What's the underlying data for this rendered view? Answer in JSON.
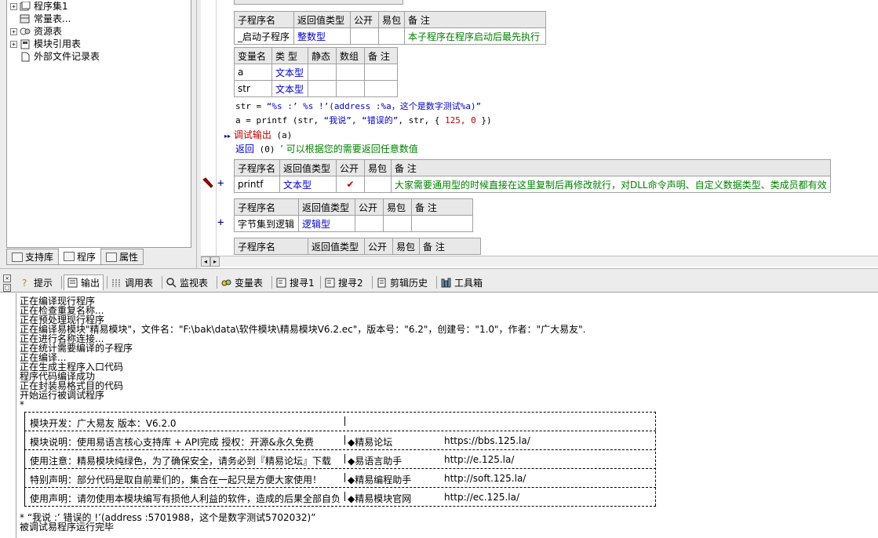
{
  "tree": {
    "items": [
      {
        "label": "程序集1",
        "icon": "assembly-icon",
        "expander": "+"
      },
      {
        "label": "常量表...",
        "icon": "constant-icon",
        "expander": ""
      },
      {
        "label": "资源表",
        "icon": "resource-icon",
        "expander": "+"
      },
      {
        "label": "模块引用表",
        "icon": "module-icon",
        "expander": "+"
      },
      {
        "label": "外部文件记录表",
        "icon": "file-icon",
        "expander": ""
      }
    ]
  },
  "left_tabs": [
    {
      "label": "支持库",
      "icon": "library-icon"
    },
    {
      "label": "程序",
      "icon": "program-icon"
    },
    {
      "label": "属性",
      "icon": "property-icon"
    }
  ],
  "editor": {
    "sub1": {
      "headers": [
        "子程序名",
        "返回值类型",
        "公开",
        "易包",
        "备 注"
      ],
      "row": [
        "_启动子程序",
        "整数型",
        "",
        "",
        "本子程序在程序启动后最先执行"
      ]
    },
    "vars": {
      "headers": [
        "变量名",
        "类 型",
        "静态",
        "数组",
        "备 注"
      ],
      "rows": [
        [
          "a",
          "文本型",
          "",
          "",
          ""
        ],
        [
          "str",
          "文本型",
          "",
          "",
          ""
        ]
      ]
    },
    "code": {
      "line1_a": "str = ",
      "line1_b": "“%s :’ %s !’(address :%a，这个是数字测试%a)”",
      "line2_a": "a = printf (str, ",
      "line2_b": "“我说”, “错误的”",
      "line2_c": ", str, { ",
      "line2_d": "125, 0",
      "line2_e": " })",
      "line3_arrow": "▸▸",
      "line3_a": "调试输出",
      "line3_b": " (a)",
      "line4_a": "返回",
      "line4_b": " (0)  ",
      "line4_c": "’ 可以根据您的需要返回任意数值"
    },
    "sub2": {
      "headers": [
        "子程序名",
        "返回值类型",
        "公开",
        "易包",
        "备 注"
      ],
      "row": [
        "printf",
        "文本型",
        "✔",
        "",
        "大家需要通用型的时候直接在这里复制后再修改就行，对DLL命令声明、自定义数据类型、类成员都有效"
      ]
    },
    "sub3": {
      "headers": [
        "子程序名",
        "返回值类型",
        "公开",
        "易包",
        "备 注"
      ],
      "row": [
        "字节集到逻辑",
        "逻辑型",
        "",
        "",
        ""
      ]
    },
    "sub4": {
      "headers": [
        "子程序名",
        "返回值类型",
        "公开",
        "易包",
        "备 注"
      ]
    },
    "plus": "+"
  },
  "bottom_tabs": [
    {
      "label": "提示",
      "icon": "hint-icon"
    },
    {
      "label": "输出",
      "icon": "output-icon"
    },
    {
      "label": "调用表",
      "icon": "callstack-icon"
    },
    {
      "label": "监视表",
      "icon": "watch-icon"
    },
    {
      "label": "变量表",
      "icon": "variables-icon"
    },
    {
      "label": "搜寻1",
      "icon": "search1-icon"
    },
    {
      "label": "搜寻2",
      "icon": "search2-icon"
    },
    {
      "label": "剪辑历史",
      "icon": "clip-history-icon"
    },
    {
      "label": "工具箱",
      "icon": "toolbox-icon"
    }
  ],
  "output": {
    "lines": [
      "正在编译现行程序",
      "正在检查重复名称...",
      "正在预处理现行程序",
      "正在编译易模块\"精易模块\"，文件名：\"F:\\bak\\data\\软件模块\\精易模块V6.2.ec\"，版本号：\"6.2\"，创建号：\"1.0\"，作者：\"广大易友\".",
      "正在进行名称连接...",
      "正在统计需要编译的子程序",
      "正在编译...",
      "正在生成主程序入口代码",
      "程序代码编译成功",
      "正在封装易格式目的代码",
      "开始运行被调试程序",
      "*"
    ],
    "box": {
      "row1_left": "模块开发：广大易友    版本：V6.2.0",
      "row2_left": "模块说明：使用易语言核心支持库 + API完成     授权：开源&永久免费",
      "row2_right_label": "◆精易论坛",
      "row2_right_url": "https://bbs.125.la/",
      "row3_left": "使用注意：精易模块纯绿色，为了确保安全，请务必到『精易论坛』下载",
      "row3_right_label": "◆易语言助手",
      "row3_right_url": "http://e.125.la/",
      "row4_left": "特别声明：部分代码是取自前辈们的，集合在一起只是方便大家使用！",
      "row4_right_label": "◆精易编程助手",
      "row4_right_url": "http://soft.125.la/",
      "row5_left": "使用声明：请勿使用本模块编写有损他人利益的软件，造成的后果全部自负",
      "row5_right_label": "◆精易模块官网",
      "row5_right_url": "http://ec.125.la/"
    },
    "tail1": "* “我说 :’ 错误的 !’(address :5701988，这个是数字测试5702032)”",
    "tail2": "被调试易程序运行完毕"
  }
}
